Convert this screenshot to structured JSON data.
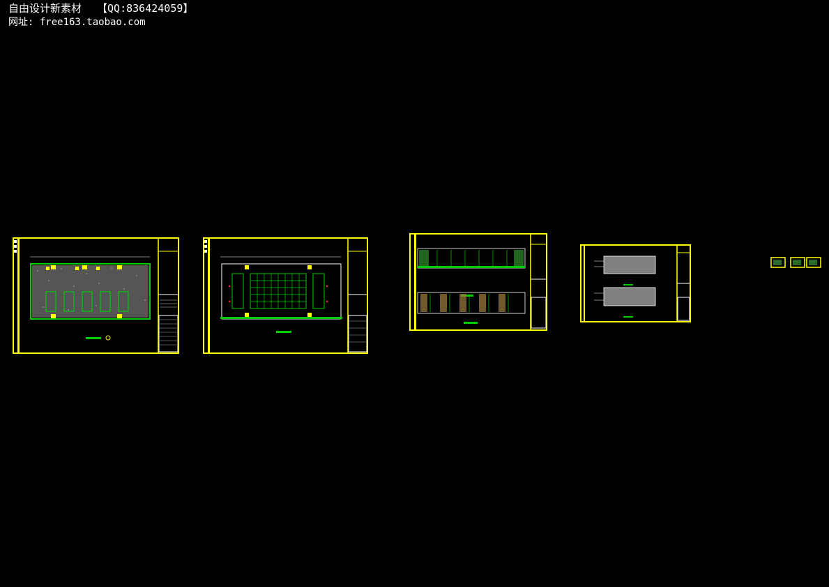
{
  "header": {
    "title": "自由设计新素材",
    "qq": "【QQ:836424059】",
    "website": "网址: free163.taobao.com"
  },
  "colors": {
    "background": "#000000",
    "frame": "#ffff00",
    "wall": "#00cc00",
    "outline": "#ffffff",
    "annotation": "#ff3333",
    "fill_gray": "#808080"
  },
  "sheets": [
    {
      "kind": "floor-plan",
      "content": "stone floor with five green furniture units"
    },
    {
      "kind": "ceiling-plan",
      "content": "grid ceiling with side panels"
    },
    {
      "kind": "elevations",
      "content": "two wall elevations"
    },
    {
      "kind": "elevations",
      "content": "two gray panel elevations"
    }
  ],
  "thumbnails": 3
}
